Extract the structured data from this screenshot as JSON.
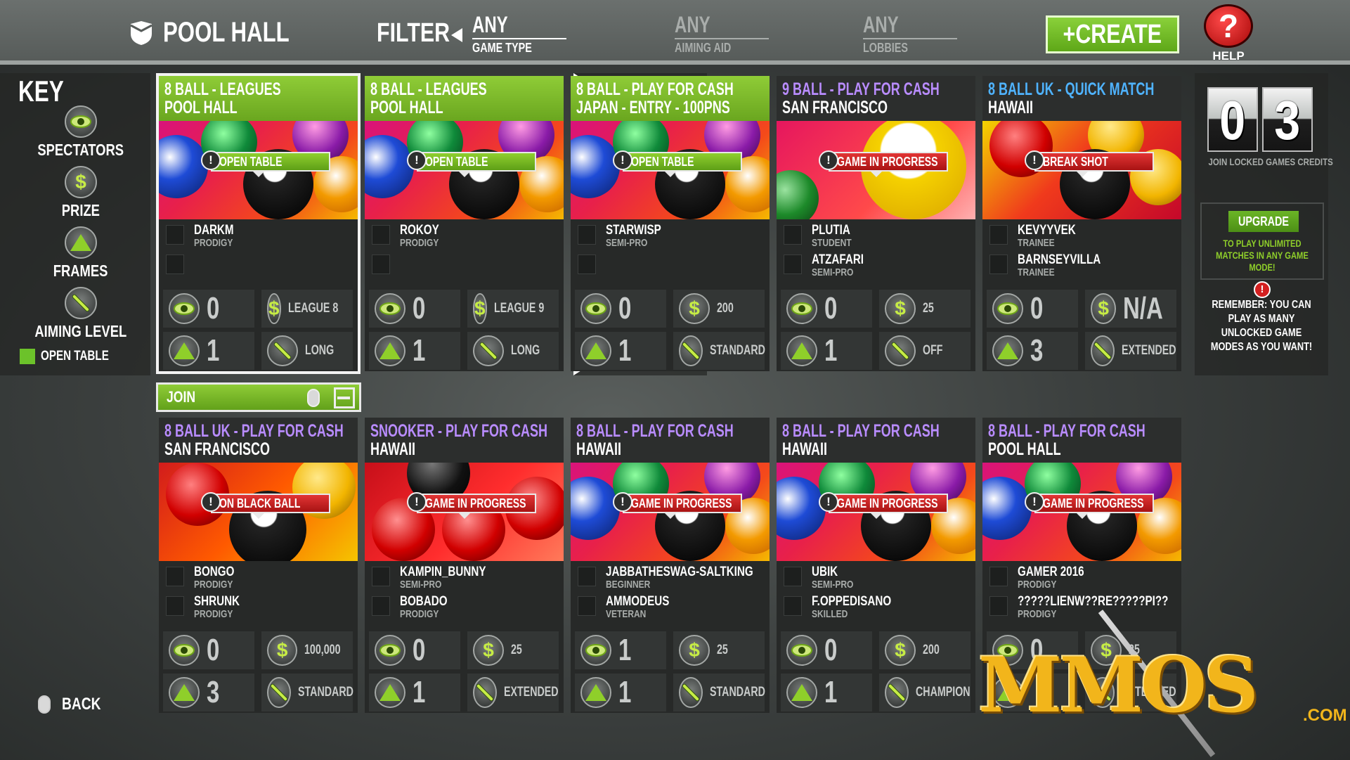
{
  "header": {
    "title": "POOL HALL",
    "filter_label": "FILTER",
    "filters": [
      {
        "value": "ANY",
        "label": "GAME TYPE"
      },
      {
        "value": "ANY",
        "label": "AIMING AID"
      },
      {
        "value": "ANY",
        "label": "LOBBIES"
      }
    ],
    "create_label": "+CREATE",
    "help_label": "HELP",
    "help_glyph": "?"
  },
  "key": {
    "title": "KEY",
    "items": [
      {
        "icon": "eye-icon",
        "label": "SPECTATORS"
      },
      {
        "icon": "dollar-icon",
        "label": "PRIZE"
      },
      {
        "icon": "triangle-icon",
        "label": "FRAMES"
      },
      {
        "icon": "cue-icon",
        "label": "AIMING LEVEL"
      }
    ],
    "open_table_label": "OPEN TABLE"
  },
  "cards": [
    {
      "mode": "8 BALL - LEAGUES",
      "location": "POOL HALL",
      "status": "OPEN TABLE",
      "p1": {
        "name": "DARKM",
        "rank": "PRODIGY"
      },
      "p2": {
        "name": "",
        "rank": ""
      },
      "spectators": "0",
      "prize": "LEAGUE 8",
      "frames": "1",
      "aiming": "LONG"
    },
    {
      "mode": "8 BALL - LEAGUES",
      "location": "POOL HALL",
      "status": "OPEN TABLE",
      "p1": {
        "name": "ROKOY",
        "rank": "PRODIGY"
      },
      "p2": {
        "name": "",
        "rank": ""
      },
      "spectators": "0",
      "prize": "LEAGUE 9",
      "frames": "1",
      "aiming": "LONG"
    },
    {
      "mode": "8 BALL - PLAY FOR CASH",
      "location": "JAPAN - ENTRY - 100PNS",
      "status": "OPEN TABLE",
      "p1": {
        "name": "STARWISP",
        "rank": "SEMI-PRO"
      },
      "p2": {
        "name": "",
        "rank": ""
      },
      "spectators": "0",
      "prize": "200",
      "frames": "1",
      "aiming": "STANDARD"
    },
    {
      "mode": "9 BALL - PLAY FOR CASH",
      "location": "SAN FRANCISCO",
      "status": "GAME IN PROGRESS",
      "p1": {
        "name": "PLUTIA",
        "rank": "STUDENT"
      },
      "p2": {
        "name": "ATZAFARI",
        "rank": "SEMI-PRO"
      },
      "spectators": "0",
      "prize": "25",
      "frames": "1",
      "aiming": "OFF"
    },
    {
      "mode": "8 BALL UK - QUICK MATCH",
      "location": "HAWAII",
      "status": "BREAK SHOT",
      "p1": {
        "name": "KEVYYVEK",
        "rank": "TRAINEE"
      },
      "p2": {
        "name": "BARNSEYVILLA",
        "rank": "TRAINEE"
      },
      "spectators": "0",
      "prize": "N/A",
      "frames": "3",
      "aiming": "EXTENDED"
    },
    {
      "mode": "8 BALL UK - PLAY FOR CASH",
      "location": "SAN FRANCISCO",
      "status": "ON BLACK BALL",
      "p1": {
        "name": "BONGO",
        "rank": "PRODIGY"
      },
      "p2": {
        "name": "SHRUNK",
        "rank": "PRODIGY"
      },
      "spectators": "0",
      "prize": "100,000",
      "frames": "3",
      "aiming": "STANDARD"
    },
    {
      "mode": "SNOOKER - PLAY FOR CASH",
      "location": "HAWAII",
      "status": "GAME IN PROGRESS",
      "p1": {
        "name": "KAMPIN_BUNNY",
        "rank": "SEMI-PRO"
      },
      "p2": {
        "name": "BOBADO",
        "rank": "PRODIGY"
      },
      "spectators": "0",
      "prize": "25",
      "frames": "1",
      "aiming": "EXTENDED"
    },
    {
      "mode": "8 BALL - PLAY FOR CASH",
      "location": "HAWAII",
      "status": "GAME IN PROGRESS",
      "p1": {
        "name": "JABBATHESWAG-SALTKING",
        "rank": "BEGINNER"
      },
      "p2": {
        "name": "AMMODEUS",
        "rank": "VETERAN"
      },
      "spectators": "1",
      "prize": "25",
      "frames": "1",
      "aiming": "STANDARD"
    },
    {
      "mode": "8 BALL - PLAY FOR CASH",
      "location": "HAWAII",
      "status": "GAME IN PROGRESS",
      "p1": {
        "name": "UBIK",
        "rank": "SEMI-PRO"
      },
      "p2": {
        "name": "F.OPPEDISANO",
        "rank": "SKILLED"
      },
      "spectators": "0",
      "prize": "200",
      "frames": "1",
      "aiming": "CHAMPION"
    },
    {
      "mode": "8 BALL - PLAY FOR CASH",
      "location": "POOL HALL",
      "status": "GAME IN PROGRESS",
      "p1": {
        "name": "GAMER 2016",
        "rank": "PRODIGY"
      },
      "p2": {
        "name": "?????LIENW??RE?????PI??",
        "rank": "PRODIGY"
      },
      "spectators": "0",
      "prize": "25",
      "frames": "",
      "aiming": "EXTENDED"
    }
  ],
  "join_label": "JOIN",
  "right_panel": {
    "digit1": "0",
    "digit2": "3",
    "credits_label": "JOIN LOCKED GAMES CREDITS",
    "upgrade_label": "UPGRADE",
    "upgrade_text": "TO PLAY UNLIMITED MATCHES IN ANY GAME MODE!",
    "remember_text": "REMEMBER: YOU CAN PLAY AS MANY UNLOCKED GAME MODES AS YOU WANT!",
    "warn_glyph": "!"
  },
  "back_label": "BACK",
  "watermark": {
    "text": "MMOS",
    "suffix": ".COM"
  },
  "colors": {
    "accent_green": "#6cc22a",
    "status_red": "#c91c1c",
    "mode_purple": "#b98cff",
    "mode_blue": "#4fb3ff"
  }
}
